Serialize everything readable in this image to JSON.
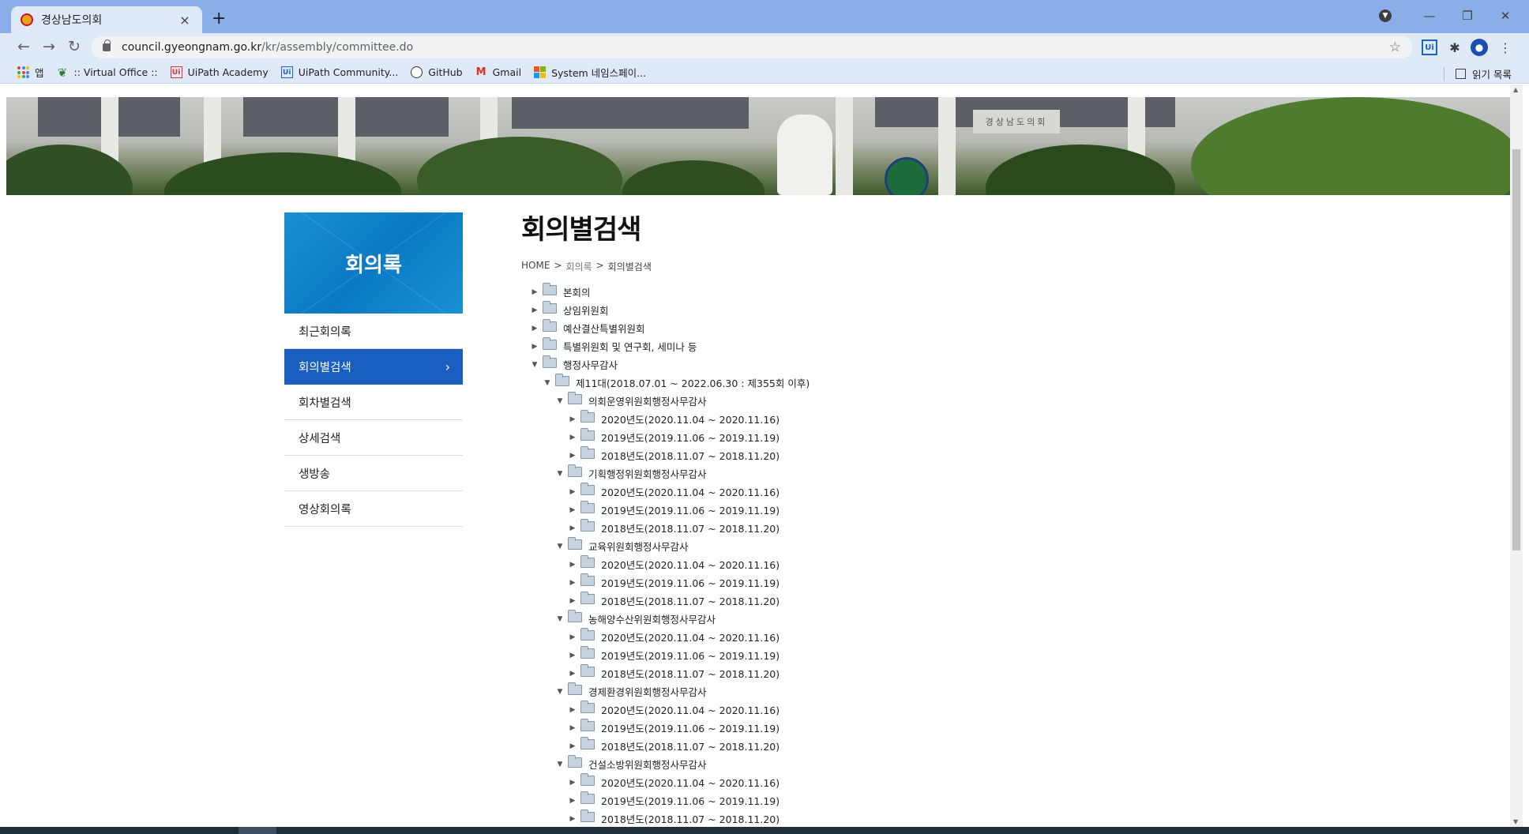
{
  "browser": {
    "tab_title": "경상남도의회",
    "tab_close": "×",
    "new_tab": "+",
    "url_host": "council.gyeongnam.go.kr",
    "url_path": "/kr/assembly/committee.do",
    "bookmarks": [
      {
        "label": "앱",
        "icon": "apps-icon"
      },
      {
        "label": ":: Virtual Office ::",
        "icon": "virtual-office-icon"
      },
      {
        "label": "UiPath Academy",
        "icon": "uipath-icon"
      },
      {
        "label": "UiPath Community...",
        "icon": "uipath-community-icon"
      },
      {
        "label": "GitHub",
        "icon": "github-icon"
      },
      {
        "label": "Gmail",
        "icon": "gmail-icon"
      },
      {
        "label": "System 네임스페이...",
        "icon": "microsoft-icon"
      }
    ],
    "reading_list": "읽기 목록"
  },
  "sidebar": {
    "title": "회의록",
    "items": [
      {
        "label": "최근회의록",
        "active": false
      },
      {
        "label": "회의별검색",
        "active": true
      },
      {
        "label": "회차별검색",
        "active": false
      },
      {
        "label": "상세검색",
        "active": false
      },
      {
        "label": "생방송",
        "active": false
      },
      {
        "label": "영상회의록",
        "active": false
      }
    ],
    "active_arrow": "›"
  },
  "main": {
    "title": "회의별검색",
    "breadcrumb": [
      "HOME",
      ">",
      "회의록",
      ">",
      "회의별검색"
    ]
  },
  "tree": [
    {
      "label": "본회의",
      "level": 0,
      "expanded": false
    },
    {
      "label": "상임위원회",
      "level": 0,
      "expanded": false
    },
    {
      "label": "예산결산특별위원회",
      "level": 0,
      "expanded": false
    },
    {
      "label": "특별위원회 및 연구회, 세미나 등",
      "level": 0,
      "expanded": false
    },
    {
      "label": "행정사무감사",
      "level": 0,
      "expanded": true
    },
    {
      "label": "제11대(2018.07.01 ~ 2022.06.30 : 제355회 이후)",
      "level": 1,
      "expanded": true
    },
    {
      "label": "의회운영위원회행정사무감사",
      "level": 2,
      "expanded": true
    },
    {
      "label": "2020년도(2020.11.04 ~ 2020.11.16)",
      "level": 3,
      "expanded": false
    },
    {
      "label": "2019년도(2019.11.06 ~ 2019.11.19)",
      "level": 3,
      "expanded": false
    },
    {
      "label": "2018년도(2018.11.07 ~ 2018.11.20)",
      "level": 3,
      "expanded": false
    },
    {
      "label": "기획행정위원회행정사무감사",
      "level": 2,
      "expanded": true
    },
    {
      "label": "2020년도(2020.11.04 ~ 2020.11.16)",
      "level": 3,
      "expanded": false
    },
    {
      "label": "2019년도(2019.11.06 ~ 2019.11.19)",
      "level": 3,
      "expanded": false
    },
    {
      "label": "2018년도(2018.11.07 ~ 2018.11.20)",
      "level": 3,
      "expanded": false
    },
    {
      "label": "교육위원회행정사무감사",
      "level": 2,
      "expanded": true
    },
    {
      "label": "2020년도(2020.11.04 ~ 2020.11.16)",
      "level": 3,
      "expanded": false
    },
    {
      "label": "2019년도(2019.11.06 ~ 2019.11.19)",
      "level": 3,
      "expanded": false
    },
    {
      "label": "2018년도(2018.11.07 ~ 2018.11.20)",
      "level": 3,
      "expanded": false
    },
    {
      "label": "농해양수산위원회행정사무감사",
      "level": 2,
      "expanded": true
    },
    {
      "label": "2020년도(2020.11.04 ~ 2020.11.16)",
      "level": 3,
      "expanded": false
    },
    {
      "label": "2019년도(2019.11.06 ~ 2019.11.19)",
      "level": 3,
      "expanded": false
    },
    {
      "label": "2018년도(2018.11.07 ~ 2018.11.20)",
      "level": 3,
      "expanded": false
    },
    {
      "label": "경제환경위원회행정사무감사",
      "level": 2,
      "expanded": true
    },
    {
      "label": "2020년도(2020.11.04 ~ 2020.11.16)",
      "level": 3,
      "expanded": false
    },
    {
      "label": "2019년도(2019.11.06 ~ 2019.11.19)",
      "level": 3,
      "expanded": false
    },
    {
      "label": "2018년도(2018.11.07 ~ 2018.11.20)",
      "level": 3,
      "expanded": false
    },
    {
      "label": "건설소방위원회행정사무감사",
      "level": 2,
      "expanded": true
    },
    {
      "label": "2020년도(2020.11.04 ~ 2020.11.16)",
      "level": 3,
      "expanded": false
    },
    {
      "label": "2019년도(2019.11.06 ~ 2019.11.19)",
      "level": 3,
      "expanded": false
    },
    {
      "label": "2018년도(2018.11.07 ~ 2018.11.20)",
      "level": 3,
      "expanded": false
    }
  ],
  "colors": {
    "sidebar_head": "#0b79c4",
    "sidebar_active": "#1a5fc0",
    "tabbar": "#8aaee8",
    "toolbar": "#dfe9f8"
  }
}
